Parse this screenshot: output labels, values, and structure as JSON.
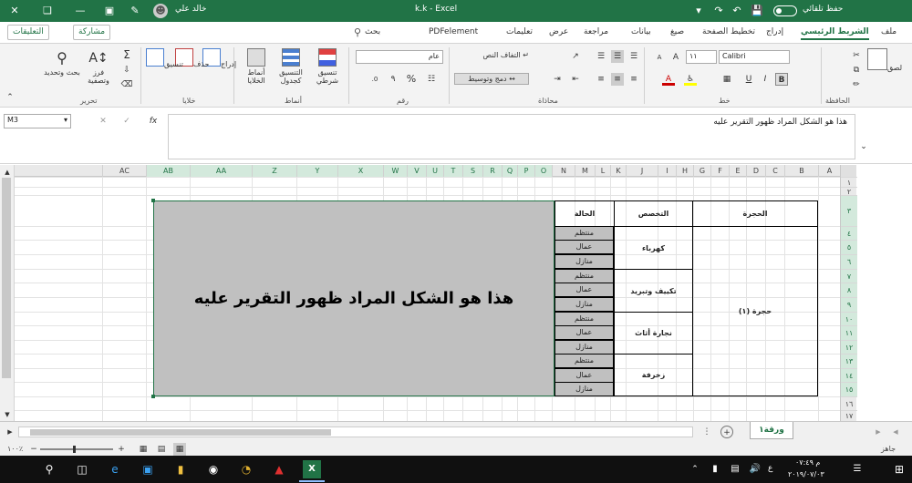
{
  "window": {
    "autosave": "حفظ تلقائي",
    "title": "k.k  -  Excel",
    "user": "خالد علي"
  },
  "tabs": [
    "ملف",
    "الشريط الرئيسي",
    "إدراج",
    "تخطيط الصفحة",
    "صيغ",
    "بيانات",
    "مراجعة",
    "عرض",
    "تعليمات",
    "PDFelement",
    "بحث"
  ],
  "top_buttons": {
    "share": "مشاركة",
    "comments": "التعليقات"
  },
  "ribbon": {
    "clipboard": {
      "group": "الحافظة",
      "paste": "لصق"
    },
    "font": {
      "group": "خط",
      "font_name": "Calibri",
      "font_size": "١١",
      "bold": "B"
    },
    "alignment": {
      "group": "محاذاة",
      "wrap_text": "التفاف النص",
      "merge_center": "دمج وتوسيط"
    },
    "number": {
      "group": "رقم",
      "format": "عام",
      "percent": "%",
      "comma": "٩"
    },
    "styles": {
      "group": "أنماط",
      "conditional": "تنسيق شرطي",
      "as_table": "التنسيق كجدول",
      "cell_styles": "أنماط الخلايا"
    },
    "cells": {
      "group": "خلايا",
      "insert": "إدراج",
      "delete": "حذف",
      "format": "تنسيق"
    },
    "editing": {
      "group": "تحرير",
      "sort": "فرز وتصفية",
      "find": "بحث وتحديد"
    }
  },
  "formula_bar": {
    "name_box": "M3",
    "content": "هذا هو الشكل المراد ظهور التقرير عليه",
    "fx": "fx"
  },
  "columns": [
    "A",
    "B",
    "C",
    "D",
    "E",
    "F",
    "G",
    "H",
    "I",
    "J",
    "K",
    "L",
    "M",
    "N",
    "O",
    "P",
    "Q",
    "R",
    "S",
    "T",
    "U",
    "V",
    "W",
    "X",
    "Y",
    "Z",
    "AA",
    "AB",
    "AC"
  ],
  "rows": [
    "١",
    "٢",
    "٣",
    "٤",
    "٥",
    "٦",
    "٧",
    "٨",
    "٩",
    "١٠",
    "١١",
    "١٢",
    "١٣",
    "١٤",
    "١٥",
    "١٦",
    "١٧"
  ],
  "table": {
    "headers": {
      "room": "الحجرة",
      "specialty": "التخصص",
      "status": "الحالة"
    },
    "room": "حجرة (١)",
    "specialties": [
      "كهرباء",
      "تكييف وتبريد",
      "نجارة أثاث",
      "زخرفة"
    ],
    "statuses": [
      "منتظم",
      "عمال",
      "منازل"
    ]
  },
  "shape_text": "هذا هو الشكل المراد ظهور التقرير عليه",
  "sheet_tab": "ورقة١",
  "status": {
    "ready": "جاهز",
    "zoom": "١٠٠٪"
  },
  "clock": {
    "time": "م ٠٧:٤٩",
    "date": "٢٠١٩/٠٧/٠٣",
    "lang": "ع"
  },
  "colors": {
    "excel_green": "#217346",
    "shape_fill": "#c0c0c0"
  }
}
